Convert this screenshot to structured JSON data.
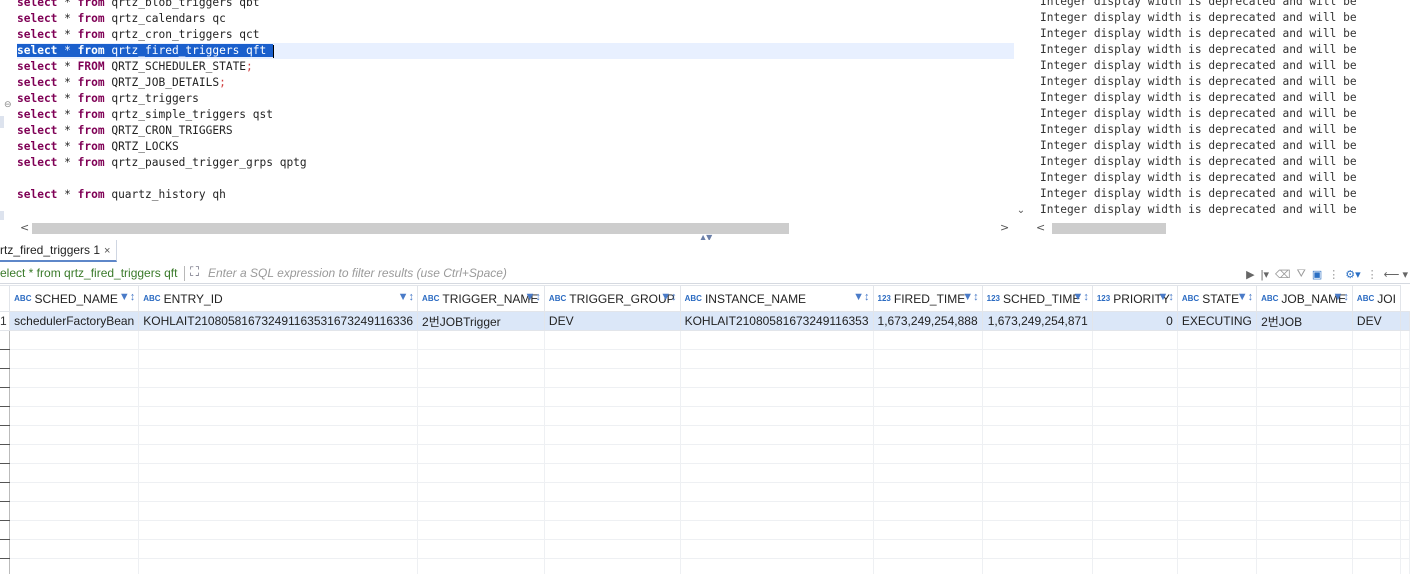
{
  "editor": {
    "lines": [
      {
        "kw": "select",
        "rest": " * ",
        "kw2": "from",
        "tail": " qrtz_blob_triggers qbt",
        "semi": ""
      },
      {
        "kw": "select",
        "rest": " * ",
        "kw2": "from",
        "tail": " qrtz_calendars qc",
        "semi": ""
      },
      {
        "kw": "select",
        "rest": " * ",
        "kw2": "from",
        "tail": " qrtz_cron_triggers qct",
        "semi": ""
      },
      {
        "kw": "select",
        "rest": " * ",
        "kw2": "from",
        "tail": " qrtz_fired_triggers qft",
        "semi": ""
      },
      {
        "kw": "select",
        "rest": " * ",
        "kw2": "FROM",
        "tail": " QRTZ_SCHEDULER_STATE",
        "semi": ";"
      },
      {
        "kw": "select",
        "rest": " * ",
        "kw2": "from",
        "tail": " QRTZ_JOB_DETAILS",
        "semi": ";"
      },
      {
        "kw": "select",
        "rest": " * ",
        "kw2": "from",
        "tail": " qrtz_triggers",
        "semi": ""
      },
      {
        "kw": "select",
        "rest": " * ",
        "kw2": "from",
        "tail": " qrtz_simple_triggers qst",
        "semi": ""
      },
      {
        "kw": "select",
        "rest": " * ",
        "kw2": "from",
        "tail": " QRTZ_CRON_TRIGGERS",
        "semi": ""
      },
      {
        "kw": "select",
        "rest": " * ",
        "kw2": "from",
        "tail": " QRTZ_LOCKS",
        "semi": ""
      },
      {
        "kw": "select",
        "rest": " * ",
        "kw2": "from",
        "tail": " qrtz_paused_trigger_grps qptg",
        "semi": ""
      },
      {
        "kw": "",
        "rest": "",
        "kw2": "",
        "tail": "",
        "semi": ""
      },
      {
        "kw": "select",
        "rest": " * ",
        "kw2": "from",
        "tail": " quartz_history qh",
        "semi": ""
      }
    ],
    "selected_line_index": 3
  },
  "output": {
    "lines": [
      "Integer display width is deprecated and will be",
      "Integer display width is deprecated and will be",
      "Integer display width is deprecated and will be",
      "Integer display width is deprecated and will be",
      "Integer display width is deprecated and will be",
      "Integer display width is deprecated and will be",
      "Integer display width is deprecated and will be",
      "Integer display width is deprecated and will be",
      "Integer display width is deprecated and will be",
      "Integer display width is deprecated and will be",
      "Integer display width is deprecated and will be",
      "Integer display width is deprecated and will be",
      "Integer display width is deprecated and will be",
      "Integer display width is deprecated and will be"
    ]
  },
  "result_tab": {
    "label": "rtz_fired_triggers 1",
    "close": "×"
  },
  "filter": {
    "query": "elect * from qrtz_fired_triggers qft",
    "placeholder": "Enter a SQL expression to filter results (use Ctrl+Space)"
  },
  "grid": {
    "columns": [
      {
        "type": "ABC",
        "name": "SCHED_NAME"
      },
      {
        "type": "ABC",
        "name": "ENTRY_ID"
      },
      {
        "type": "ABC",
        "name": "TRIGGER_NAME"
      },
      {
        "type": "ABC",
        "name": "TRIGGER_GROUP"
      },
      {
        "type": "ABC",
        "name": "INSTANCE_NAME"
      },
      {
        "type": "123",
        "name": "FIRED_TIME"
      },
      {
        "type": "123",
        "name": "SCHED_TIME"
      },
      {
        "type": "123",
        "name": "PRIORITY"
      },
      {
        "type": "ABC",
        "name": "STATE"
      },
      {
        "type": "ABC",
        "name": "JOB_NAME"
      },
      {
        "type": "ABC",
        "name": "JOI"
      }
    ],
    "rows": [
      {
        "num": "1",
        "cells": [
          "schedulerFactoryBean",
          "KOHLAIT210805816732491163531673249116336",
          "2번JOBTrigger",
          "DEV",
          "KOHLAIT21080581673249116353",
          "1,673,249,254,888",
          "1,673,249,254,871",
          "0",
          "EXECUTING",
          "2번JOB",
          "DEV"
        ]
      }
    ]
  }
}
